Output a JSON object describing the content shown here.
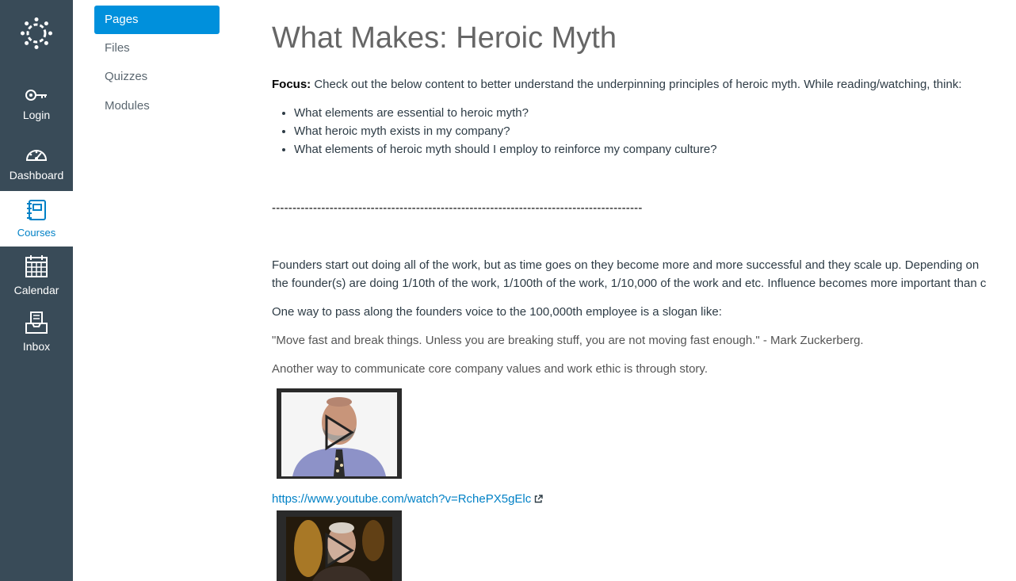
{
  "global_nav": {
    "items": [
      {
        "label": "Login",
        "icon": "key-icon"
      },
      {
        "label": "Dashboard",
        "icon": "dashboard-icon"
      },
      {
        "label": "Courses",
        "icon": "courses-icon",
        "active": true
      },
      {
        "label": "Calendar",
        "icon": "calendar-icon"
      },
      {
        "label": "Inbox",
        "icon": "inbox-icon"
      }
    ],
    "background": "#394b58",
    "active_color": "#0081c6"
  },
  "course_nav": {
    "items": [
      {
        "label": "Pages",
        "active": true
      },
      {
        "label": "Files"
      },
      {
        "label": "Quizzes"
      },
      {
        "label": "Modules"
      }
    ],
    "active_background": "#0090dc"
  },
  "page": {
    "title": "What Makes: Heroic Myth",
    "focus_label": "Focus:",
    "focus_text": " Check out the below content to better understand the underpinning principles of heroic myth. While reading/watching, think:",
    "questions": [
      "What elements are essential to heroic myth?",
      "What heroic myth exists in my company?",
      "What elements of heroic myth should I employ to reinforce my company culture?"
    ],
    "divider": "------------------------------------------------------------------------------------------",
    "para1": "Founders start out doing all of the work, but as time goes on they become more and more successful and they scale up.  Depending on",
    "para2": "the founder(s) are doing 1/10th of the work, 1/100th of the work, 1/10,000 of the work and etc.  Influence becomes more important than c",
    "para3": "One way to pass along the founders voice to the 100,000th employee is a slogan like:",
    "quote": "\"Move fast and break things. Unless you are breaking stuff, you are not moving fast enough.\" - Mark Zuckerberg.",
    "para4": "Another way to communicate core company values and work ethic is through story.",
    "link": "https://www.youtube.com/watch?v=RchePX5gElc",
    "link_color": "#0081c6"
  }
}
